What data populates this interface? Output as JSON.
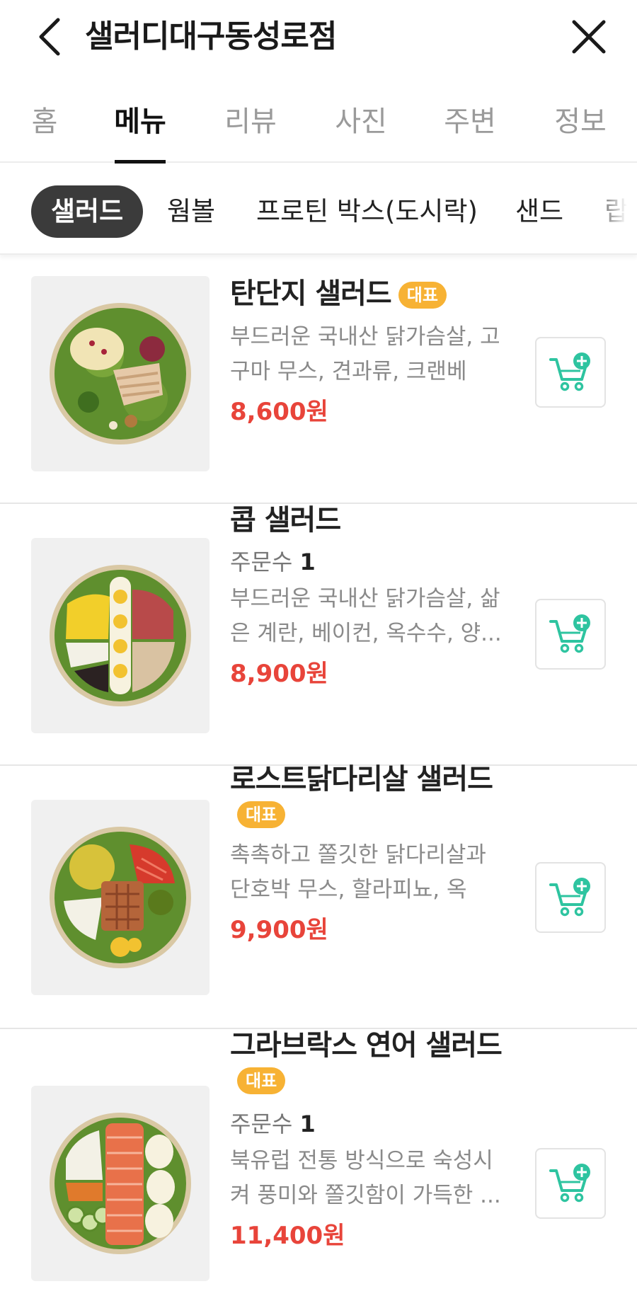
{
  "header": {
    "title": "샐러디대구동성로점"
  },
  "tabs": [
    {
      "label": "홈",
      "active": false
    },
    {
      "label": "메뉴",
      "active": true
    },
    {
      "label": "리뷰",
      "active": false
    },
    {
      "label": "사진",
      "active": false
    },
    {
      "label": "주변",
      "active": false
    },
    {
      "label": "정보",
      "active": false
    }
  ],
  "categories": [
    {
      "label": "샐러드",
      "active": true
    },
    {
      "label": "웜볼",
      "active": false
    },
    {
      "label": "프로틴 박스(도시락)",
      "active": false
    },
    {
      "label": "샌드",
      "active": false
    },
    {
      "label": "랍",
      "active": false
    }
  ],
  "menu": [
    {
      "name": "탄단지 샐러드",
      "badge": "대표",
      "orders_label": "",
      "orders_count": "",
      "desc": "부드러운 국내산 닭가슴살, 고구마 무스, 견과류, 크랜베리...",
      "price": "8,600원",
      "image": "salad-chicken-sweetpotato-image"
    },
    {
      "name": "콥 샐러드",
      "badge": "",
      "orders_label": "주문수",
      "orders_count": "1",
      "desc": "부드러운 국내산 닭가슴살, 삶은 계란, 베이컨, 옥수수, 양...",
      "price": "8,900원",
      "image": "salad-cobb-image"
    },
    {
      "name": "로스트닭다리살 샐러드",
      "badge": "대표",
      "orders_label": "",
      "orders_count": "",
      "desc": "촉촉하고 쫄깃한 닭다리살과 단호박 무스, 할라피뇨, 옥수...",
      "price": "9,900원",
      "image": "salad-roast-chicken-image"
    },
    {
      "name": "그라브락스 연어 샐러드",
      "badge": "대표",
      "orders_label": "주문수",
      "orders_count": "1",
      "desc": "북유럽 전통 방식으로 숙성시켜 풍미와 쫄깃함이 가득한 ...",
      "price": "11,400원",
      "image": "salad-salmon-image"
    }
  ],
  "colors": {
    "accent_price": "#e8443a",
    "badge": "#f7b234",
    "cart_icon": "#2ec4a0",
    "chip_active_bg": "#3b3b3b"
  },
  "icons": {
    "back": "chevron-left-icon",
    "close": "close-icon",
    "cart": "cart-add-icon"
  }
}
